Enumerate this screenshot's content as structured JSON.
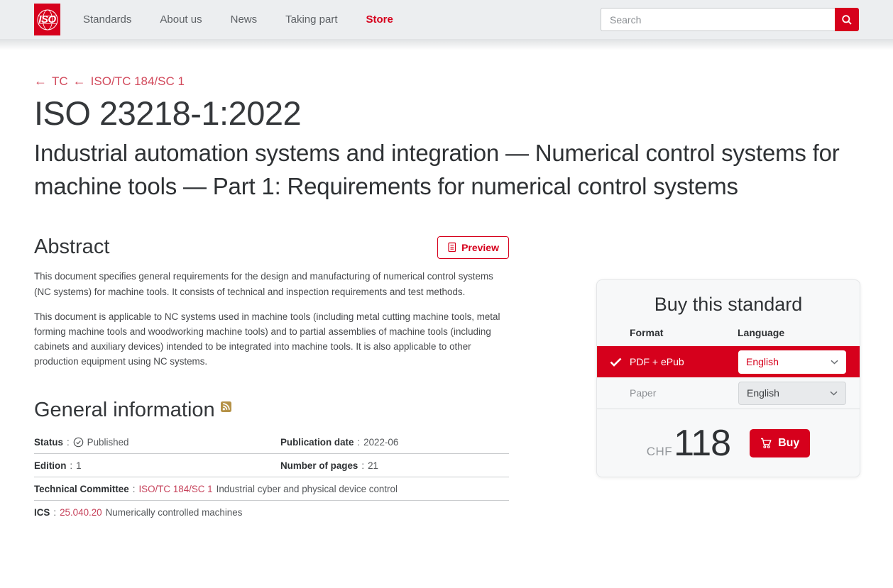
{
  "header": {
    "logo_text": "ISO",
    "nav_items": [
      {
        "label": "Standards"
      },
      {
        "label": "About us"
      },
      {
        "label": "News"
      },
      {
        "label": "Taking part"
      },
      {
        "label": "Store"
      }
    ],
    "search_placeholder": "Search"
  },
  "breadcrumb": {
    "back_arrow": "←",
    "items": [
      {
        "label": "TC"
      },
      {
        "label": "ISO/TC 184/SC 1"
      }
    ]
  },
  "document": {
    "title": "ISO 23218-1:2022",
    "subtitle": "Industrial automation systems and integration — Numerical control systems for machine tools — Part 1: Requirements for numerical control systems"
  },
  "abstract": {
    "heading": "Abstract",
    "preview_button": "Preview",
    "paragraphs": [
      "This document specifies general requirements for the design and manufacturing of numerical control systems (NC systems) for machine tools. It consists of technical and inspection requirements and test methods.",
      "This document is applicable to NC systems used in machine tools (including metal cutting machine tools, metal forming machine tools and woodworking machine tools) and to partial assemblies of machine tools (including cabinets and auxiliary devices) intended to be integrated into machine tools. It is also applicable to other production equipment using NC systems."
    ]
  },
  "general_info": {
    "heading": "General information",
    "separator": ":",
    "status_label": "Status",
    "status_value": "Published",
    "publication_date_label": "Publication date",
    "publication_date_value": "2022-06",
    "edition_label": "Edition",
    "edition_value": "1",
    "pages_label": "Number of pages",
    "pages_value": "21",
    "technical_committee_label": "Technical Committee",
    "technical_committee_link": "ISO/TC 184/SC 1",
    "technical_committee_value": "Industrial cyber and physical device control",
    "ics_label": "ICS",
    "ics_link": "25.040.20",
    "ics_value": "Numerically controlled machines"
  },
  "buy_card": {
    "title": "Buy this standard",
    "format_header": "Format",
    "language_header": "Language",
    "rows": [
      {
        "format": "PDF + ePub",
        "language": "English",
        "selected": true
      },
      {
        "format": "Paper",
        "language": "English",
        "selected": false
      }
    ],
    "currency": "CHF",
    "price": "118",
    "buy_button": "Buy"
  },
  "colors": {
    "brand_red": "#d6001c",
    "header_bg": "#eceef0",
    "card_bg": "#f7f8f9",
    "link_red": "#c6415a",
    "rss_gold": "#b59247"
  }
}
